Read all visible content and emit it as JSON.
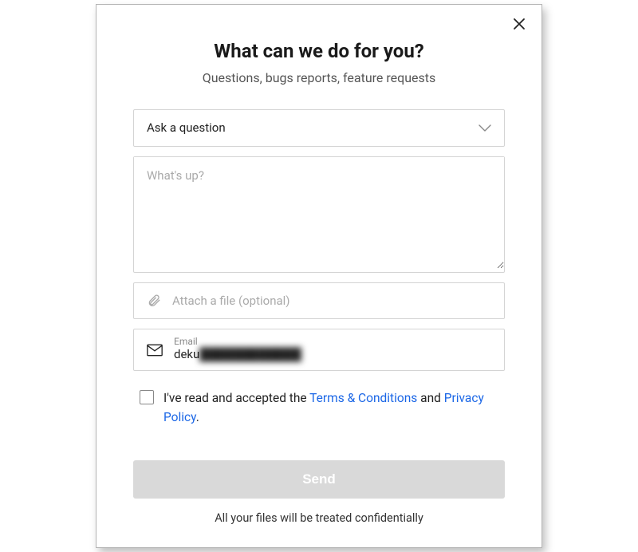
{
  "header": {
    "title": "What can we do for you?",
    "subtitle": "Questions, bugs reports, feature requests"
  },
  "form": {
    "category": {
      "selected": "Ask a question"
    },
    "message": {
      "placeholder": "What's up?",
      "value": ""
    },
    "attach": {
      "label": "Attach a file (optional)"
    },
    "email": {
      "label": "Email",
      "value_visible": "deku",
      "value_obscured": "████████████"
    },
    "consent": {
      "prefix": "I've read and accepted the ",
      "terms_link": "Terms & Conditions",
      "middle": " and ",
      "privacy_link": "Privacy Policy",
      "suffix": "."
    },
    "send_label": "Send"
  },
  "footnote": "All your files will be treated confidentially"
}
